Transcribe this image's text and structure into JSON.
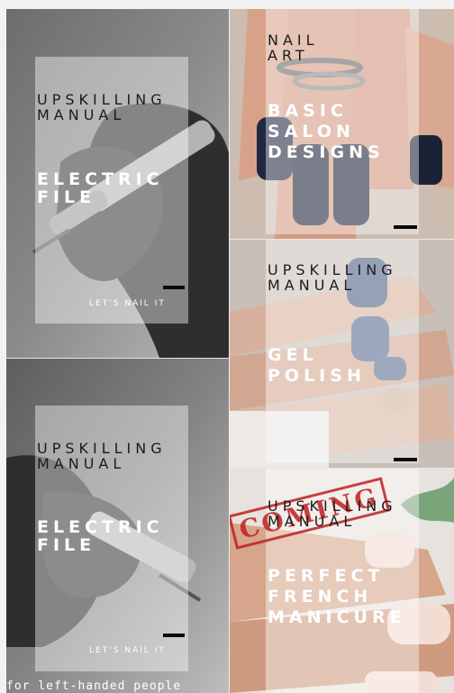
{
  "cards": [
    {
      "id": "electric-file-1",
      "kicker_line1": "UPSKILLING",
      "kicker_line2": "MANUAL",
      "title_line1": "ELECTRIC",
      "title_line2": "FILE",
      "tagline": "LET'S NAIL IT"
    },
    {
      "id": "nail-art",
      "kicker_line1": "NAIL",
      "kicker_line2": "ART",
      "title_line1": "BASIC",
      "title_line2": "SALON",
      "title_line3": "DESIGNS"
    },
    {
      "id": "gel-polish",
      "kicker_line1": "UPSKILLING",
      "kicker_line2": "MANUAL",
      "title_line1": "GEL",
      "title_line2": "POLISH"
    },
    {
      "id": "electric-file-2",
      "kicker_line1": "UPSKILLING",
      "kicker_line2": "MANUAL",
      "title_line1": "ELECTRIC",
      "title_line2": "FILE",
      "tagline": "LET'S NAIL IT",
      "caption": "for left-handed people"
    },
    {
      "id": "french-manicure",
      "stamp": "COMING",
      "kicker_line1": "UPSKILLING",
      "kicker_line2": "MANUAL",
      "title_line1": "PERFECT",
      "title_line2": "FRENCH",
      "title_line3": "MANICURE"
    }
  ]
}
